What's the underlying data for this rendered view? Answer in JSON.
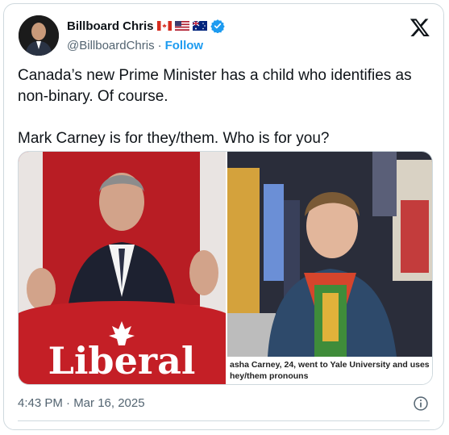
{
  "author": {
    "display_name": "Billboard Chris",
    "handle": "@BillboardChris",
    "follow_label": "Follow",
    "flags": [
      "canada-flag-icon",
      "usa-flag-icon",
      "australia-flag-icon"
    ],
    "verified_icon": "verified-badge-icon"
  },
  "tweet": {
    "line1": "Canada’s new Prime Minister has a child who identifies as",
    "line2": "non-binary. Of course.",
    "line3": "Mark Carney is for they/them. Who is for you?"
  },
  "media": {
    "left": {
      "sign_text": "Liberal"
    },
    "right": {
      "caption_line1": "asha Carney, 24, went to Yale University and uses",
      "caption_line2": "hey/them pronouns"
    }
  },
  "timestamp": "4:43 PM · Mar 16, 2025",
  "colors": {
    "accent": "#1d9bf0",
    "liberal_red": "#d71920"
  }
}
